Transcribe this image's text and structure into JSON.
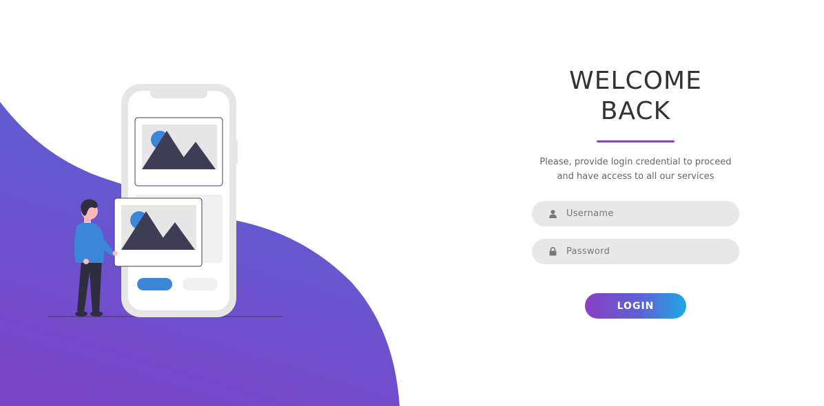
{
  "login": {
    "title_line1": "WELCOME",
    "title_line2": "BACK",
    "subtitle_line1": "Please, provide login credential to proceed",
    "subtitle_line2": "and have access to all our services",
    "username": {
      "placeholder": "Username",
      "value": ""
    },
    "password": {
      "placeholder": "Password",
      "value": ""
    },
    "login_label": "LOGIN"
  },
  "icons": {
    "username": "user-icon",
    "password": "lock-icon"
  },
  "colors": {
    "wave_top": "#5a62d3",
    "wave_bottom": "#7b45c8",
    "accent_line": "#7b4ac4",
    "button_start": "#8a3fc4",
    "button_end": "#1ea8e6",
    "field_bg": "#e8e8e8",
    "phone_blue": "#3b86d8",
    "figure_dark": "#3f3d56"
  }
}
